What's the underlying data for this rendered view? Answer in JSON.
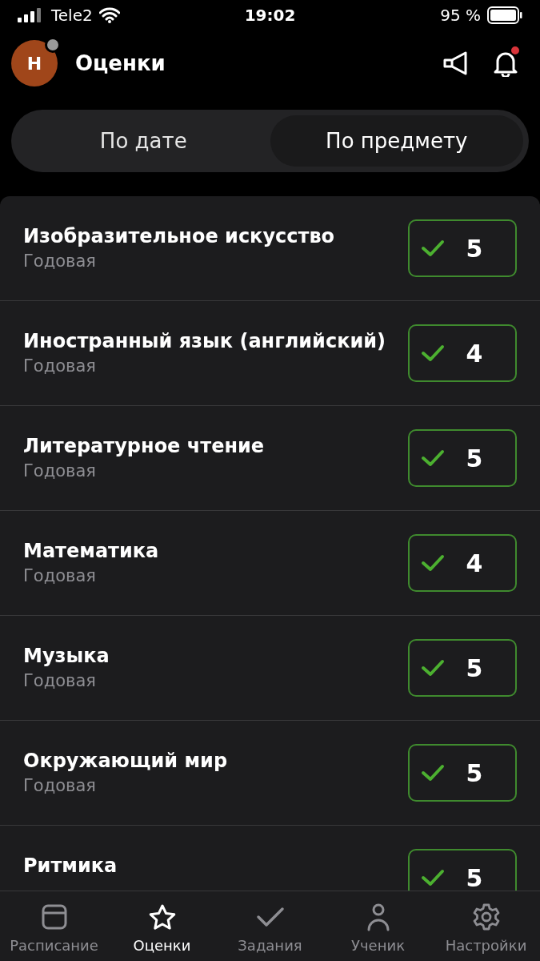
{
  "status_bar": {
    "carrier": "Tele2",
    "time": "19:02",
    "battery": "95 %"
  },
  "header": {
    "avatar_letter": "Н",
    "title": "Оценки",
    "bell_badge": true
  },
  "tabs": [
    {
      "label": "По дате",
      "selected": false
    },
    {
      "label": "По предмету",
      "selected": true
    }
  ],
  "subjects": [
    {
      "name": "Изобразительное искусство",
      "period": "Годовая",
      "grade": "5"
    },
    {
      "name": "Иностранный язык (английский)",
      "period": "Годовая",
      "grade": "4"
    },
    {
      "name": "Литературное чтение",
      "period": "Годовая",
      "grade": "5"
    },
    {
      "name": "Математика",
      "period": "Годовая",
      "grade": "4"
    },
    {
      "name": "Музыка",
      "period": "Годовая",
      "grade": "5"
    },
    {
      "name": "Окружающий мир",
      "period": "Годовая",
      "grade": "5"
    },
    {
      "name": "Ритмика",
      "grade": "5"
    }
  ],
  "nav": [
    {
      "kind": "calendar",
      "label": "Расписание",
      "selected": false
    },
    {
      "kind": "star",
      "label": "Оценки",
      "selected": true
    },
    {
      "kind": "check",
      "label": "Задания",
      "selected": false
    },
    {
      "kind": "person",
      "label": "Ученик",
      "selected": false
    },
    {
      "kind": "gear",
      "label": "Настройки",
      "selected": false
    }
  ]
}
